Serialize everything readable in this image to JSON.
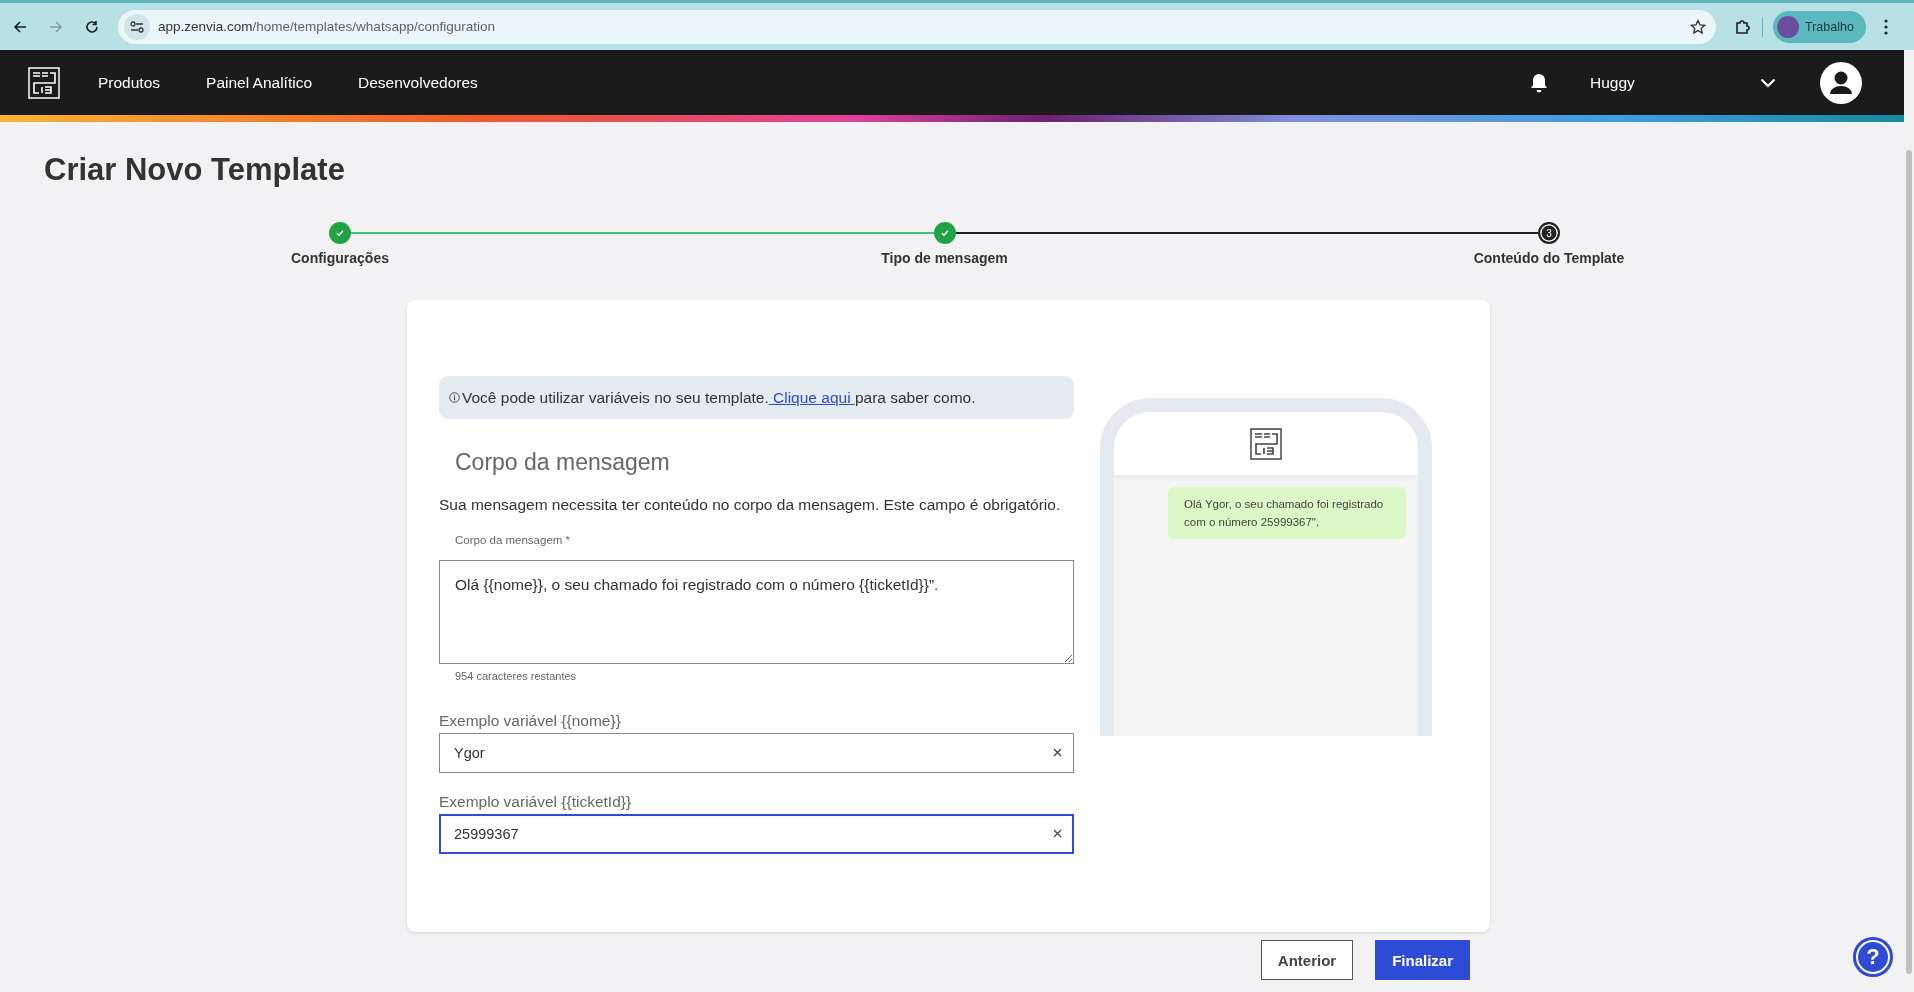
{
  "browser": {
    "url_host": "app.zenvia.com",
    "url_path": "/home/templates/whatsapp/configuration",
    "profile": "Trabalho"
  },
  "nav": {
    "items": [
      "Produtos",
      "Painel Analítico",
      "Desenvolvedores"
    ],
    "user": "Huggy"
  },
  "page_title": "Criar Novo Template",
  "steps": [
    {
      "label": "Configurações",
      "done": true
    },
    {
      "label": "Tipo de mensagem",
      "done": true
    },
    {
      "label": "Conteúdo do Template",
      "done": false,
      "number": "3"
    }
  ],
  "info": {
    "text": "Você pode utilizar variáveis no seu template.",
    "link": " Clique aqui ",
    "after": "para saber como."
  },
  "section_title": "Corpo da mensagem",
  "description": "Sua mensagem necessita ter conteúdo no corpo da mensagem. Este campo é obrigatório.",
  "body_field": {
    "label": "Corpo da mensagem *",
    "value": "Olá {{nome}}, o seu chamado foi registrado com o número {{ticketId}}”.",
    "counter": "954 caracteres restantes"
  },
  "variables": [
    {
      "label": "Exemplo variável {{nome}}",
      "value": "Ygor",
      "focused": false
    },
    {
      "label": "Exemplo variável {{ticketId}}",
      "value": "25999367",
      "focused": true
    }
  ],
  "preview": {
    "message": "Olá Ygor, o seu chamado foi registrado com o número 25999367\"."
  },
  "buttons": [
    {
      "label": "Anterior",
      "kind": "secondary"
    },
    {
      "label": "Finalizar",
      "kind": "primary"
    }
  ],
  "help_button": {
    "label": "?"
  }
}
